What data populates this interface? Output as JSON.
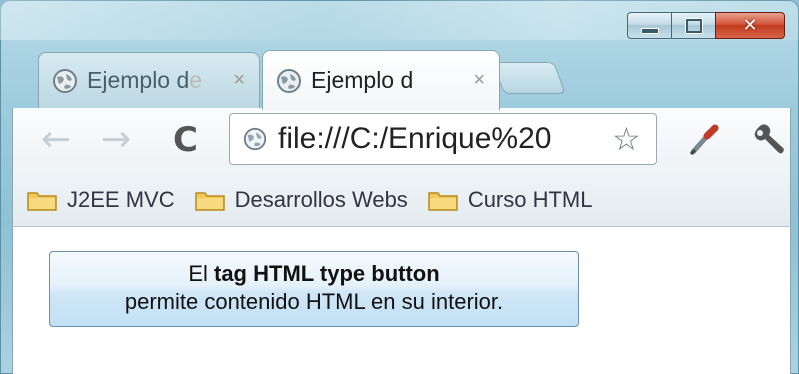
{
  "window": {
    "controls": {
      "minimize": "minimize",
      "maximize": "maximize",
      "close": "✕"
    }
  },
  "tabs": [
    {
      "title": "Ejemplo d",
      "fade": "e",
      "close": "×",
      "active": false
    },
    {
      "title": "Ejemplo d",
      "fade": "",
      "close": "×",
      "active": true
    }
  ],
  "toolbar": {
    "back_icon": "←",
    "forward_icon": "→",
    "reload_icon": "C",
    "url": "file:///C:/Enrique%20",
    "star_icon": "☆"
  },
  "bookmarks": [
    {
      "label": "J2EE MVC"
    },
    {
      "label": "Desarrollos Webs"
    },
    {
      "label": "Curso HTML"
    }
  ],
  "content": {
    "button": {
      "line1_prefix": "El ",
      "line1_bold": "tag HTML type button",
      "line2": "permite contenido HTML en su interior."
    }
  },
  "colors": {
    "frame": "#8ec1d4",
    "close_button": "#c13a1e",
    "button_face": "#cfe6f6",
    "folder": "#f0c95a"
  }
}
